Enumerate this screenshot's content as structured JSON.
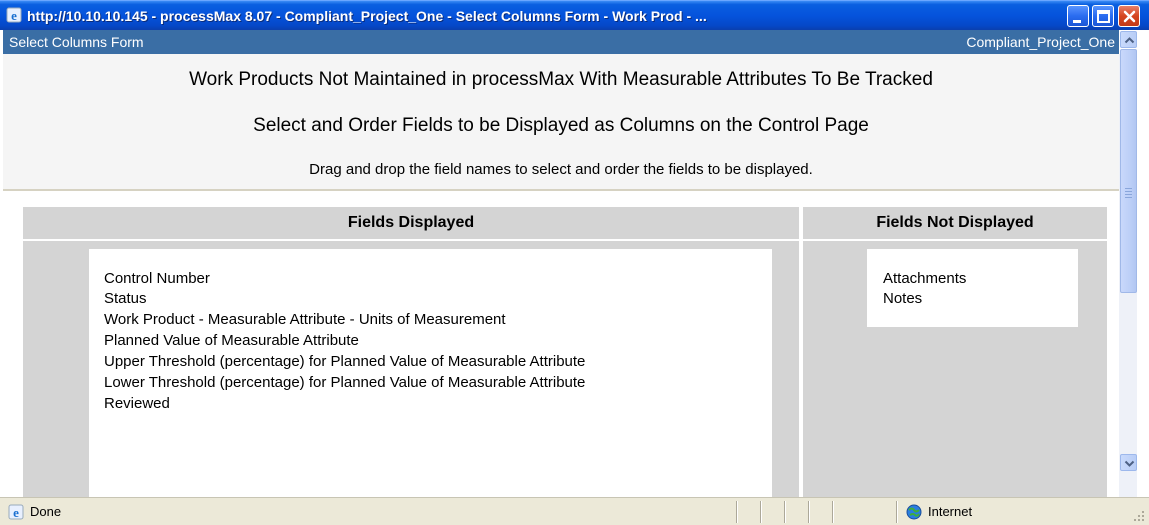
{
  "window": {
    "title": "http://10.10.10.145 - processMax 8.07 - Compliant_Project_One - Select Columns Form - Work Prod - ...",
    "minimize_icon": "minimize-icon",
    "maximize_icon": "maximize-icon",
    "close_icon": "close-icon"
  },
  "header": {
    "form_name": "Select Columns Form",
    "project_name": "Compliant_Project_One"
  },
  "page": {
    "heading": "Work Products Not Maintained in processMax With Measurable Attributes To Be Tracked",
    "subheading": "Select and Order Fields to be Displayed as Columns on the Control Page",
    "instructions": "Drag and drop the field names to select and order the fields to be displayed."
  },
  "columns": {
    "displayed": {
      "header": "Fields Displayed",
      "fields": [
        "Control Number",
        "Status",
        "Work Product - Measurable Attribute - Units of Measurement",
        "Planned Value of Measurable Attribute",
        "Upper Threshold (percentage) for Planned Value of Measurable Attribute",
        "Lower Threshold (percentage) for Planned Value of Measurable Attribute",
        "Reviewed"
      ]
    },
    "not_displayed": {
      "header": "Fields Not Displayed",
      "fields": [
        "Attachments",
        "Notes"
      ]
    }
  },
  "statusbar": {
    "status": "Done",
    "zone": "Internet"
  },
  "colors": {
    "titlebar": "#0553dc",
    "header_strip": "#3a6ea5",
    "panel_gray": "#d4d4d4",
    "statusbar": "#ece9d8"
  }
}
